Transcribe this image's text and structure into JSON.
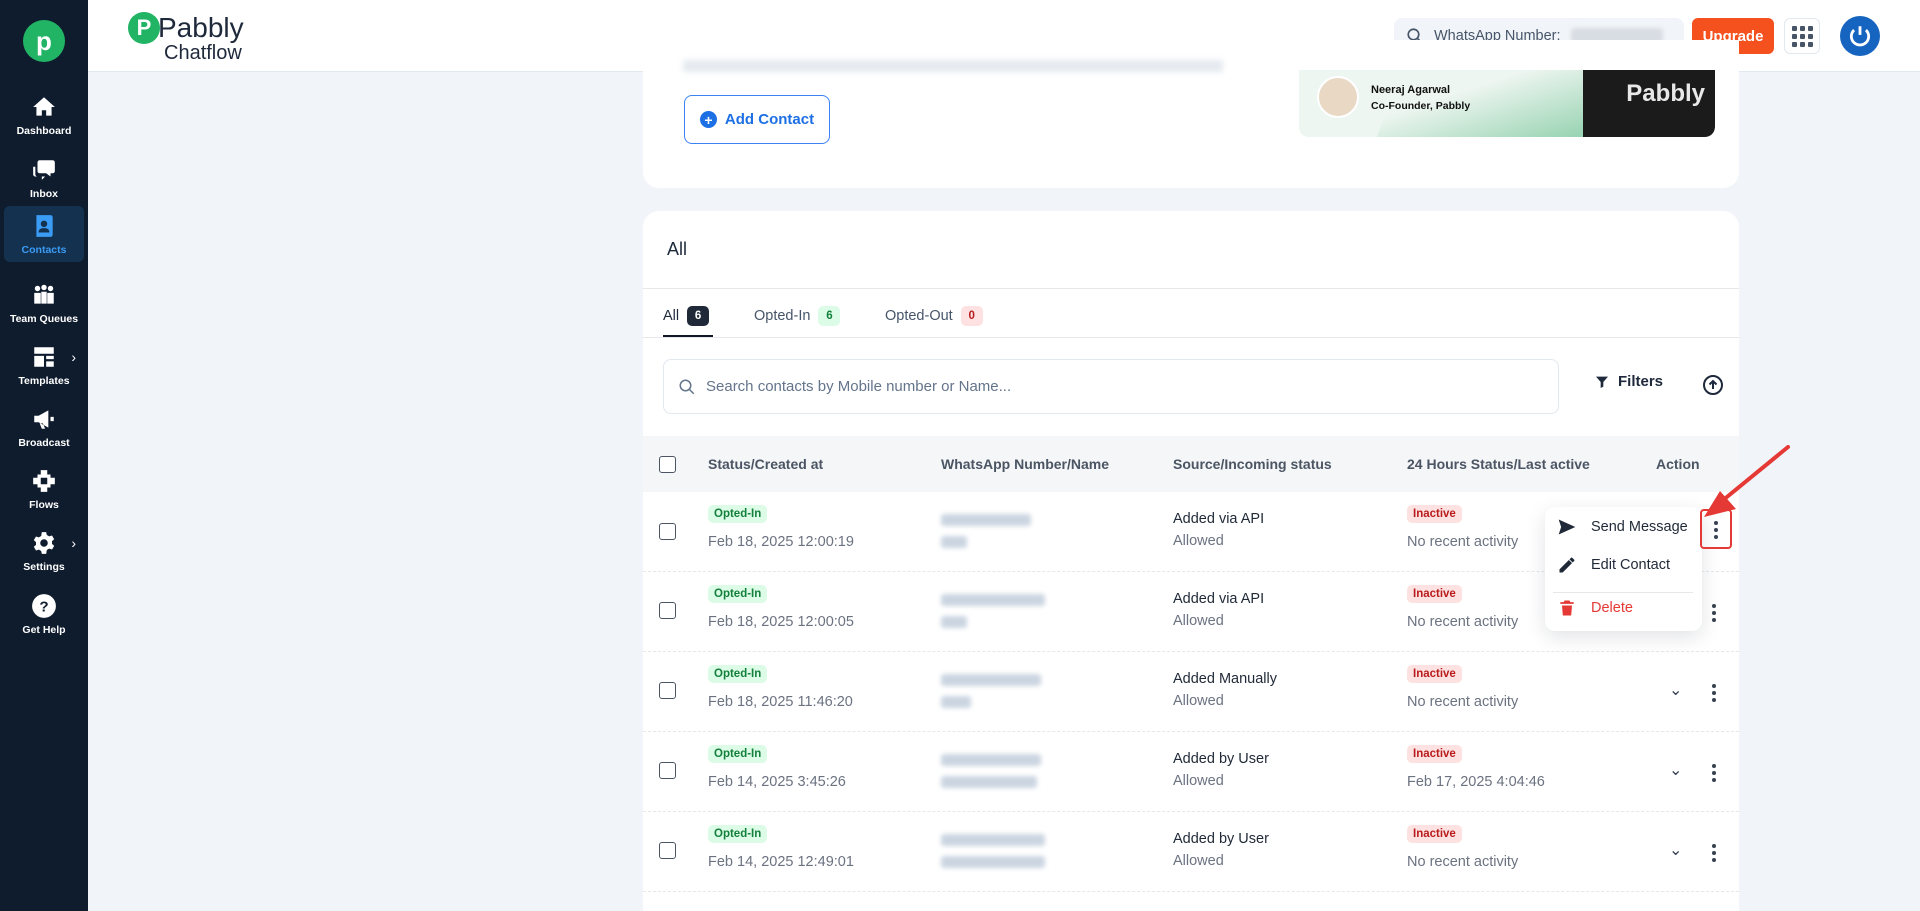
{
  "sidebar": {
    "logo": "p",
    "items": [
      {
        "label": "Dashboard",
        "icon": "home-icon"
      },
      {
        "label": "Inbox",
        "icon": "chat-icon"
      },
      {
        "label": "Contacts",
        "icon": "contacts-icon"
      },
      {
        "label": "Team Queues",
        "icon": "team-icon"
      },
      {
        "label": "Templates",
        "icon": "templates-icon"
      },
      {
        "label": "Broadcast",
        "icon": "megaphone-icon"
      },
      {
        "label": "Flows",
        "icon": "flows-icon"
      },
      {
        "label": "Settings",
        "icon": "gear-icon"
      },
      {
        "label": "Get Help",
        "icon": "help-icon"
      }
    ]
  },
  "header": {
    "brand_name": "Pabbly",
    "brand_sub": "Chatflow",
    "wa_label": "WhatsApp Number:",
    "upgrade_label": "Upgrade"
  },
  "topcard": {
    "add_contact_label": "Add Contact",
    "banner_name": "Neeraj Agarwal",
    "banner_title": "Co-Founder, Pabbly",
    "banner_brand": "Pabbly"
  },
  "main": {
    "title": "All",
    "tabs": [
      {
        "label": "All",
        "count": "6"
      },
      {
        "label": "Opted-In",
        "count": "6"
      },
      {
        "label": "Opted-Out",
        "count": "0"
      }
    ],
    "search_placeholder": "Search contacts by Mobile number or Name...",
    "filters_label": "Filters",
    "columns": {
      "status": "Status/Created at",
      "number": "WhatsApp Number/Name",
      "source": "Source/Incoming status",
      "hours": "24 Hours Status/Last active",
      "action": "Action"
    },
    "rows": [
      {
        "status": "Opted-In",
        "created": "Feb 18, 2025 12:00:19",
        "source": "Added via API",
        "incoming": "Allowed",
        "hours": "Inactive",
        "last": "No recent activity"
      },
      {
        "status": "Opted-In",
        "created": "Feb 18, 2025 12:00:05",
        "source": "Added via API",
        "incoming": "Allowed",
        "hours": "Inactive",
        "last": "No recent activity"
      },
      {
        "status": "Opted-In",
        "created": "Feb 18, 2025 11:46:20",
        "source": "Added Manually",
        "incoming": "Allowed",
        "hours": "Inactive",
        "last": "No recent activity"
      },
      {
        "status": "Opted-In",
        "created": "Feb 14, 2025 3:45:26",
        "source": "Added by User",
        "incoming": "Allowed",
        "hours": "Inactive",
        "last": "Feb 17, 2025 4:04:46"
      },
      {
        "status": "Opted-In",
        "created": "Feb 14, 2025 12:49:01",
        "source": "Added by User",
        "incoming": "Allowed",
        "hours": "Inactive",
        "last": "No recent activity"
      }
    ]
  },
  "action_menu": {
    "send": "Send Message",
    "edit": "Edit Contact",
    "delete": "Delete"
  },
  "colors": {
    "sidebar_bg": "#0f1c2e",
    "accent_blue": "#3b9cf6",
    "upgrade_orange": "#f4511e",
    "highlight_red": "#e53935"
  }
}
